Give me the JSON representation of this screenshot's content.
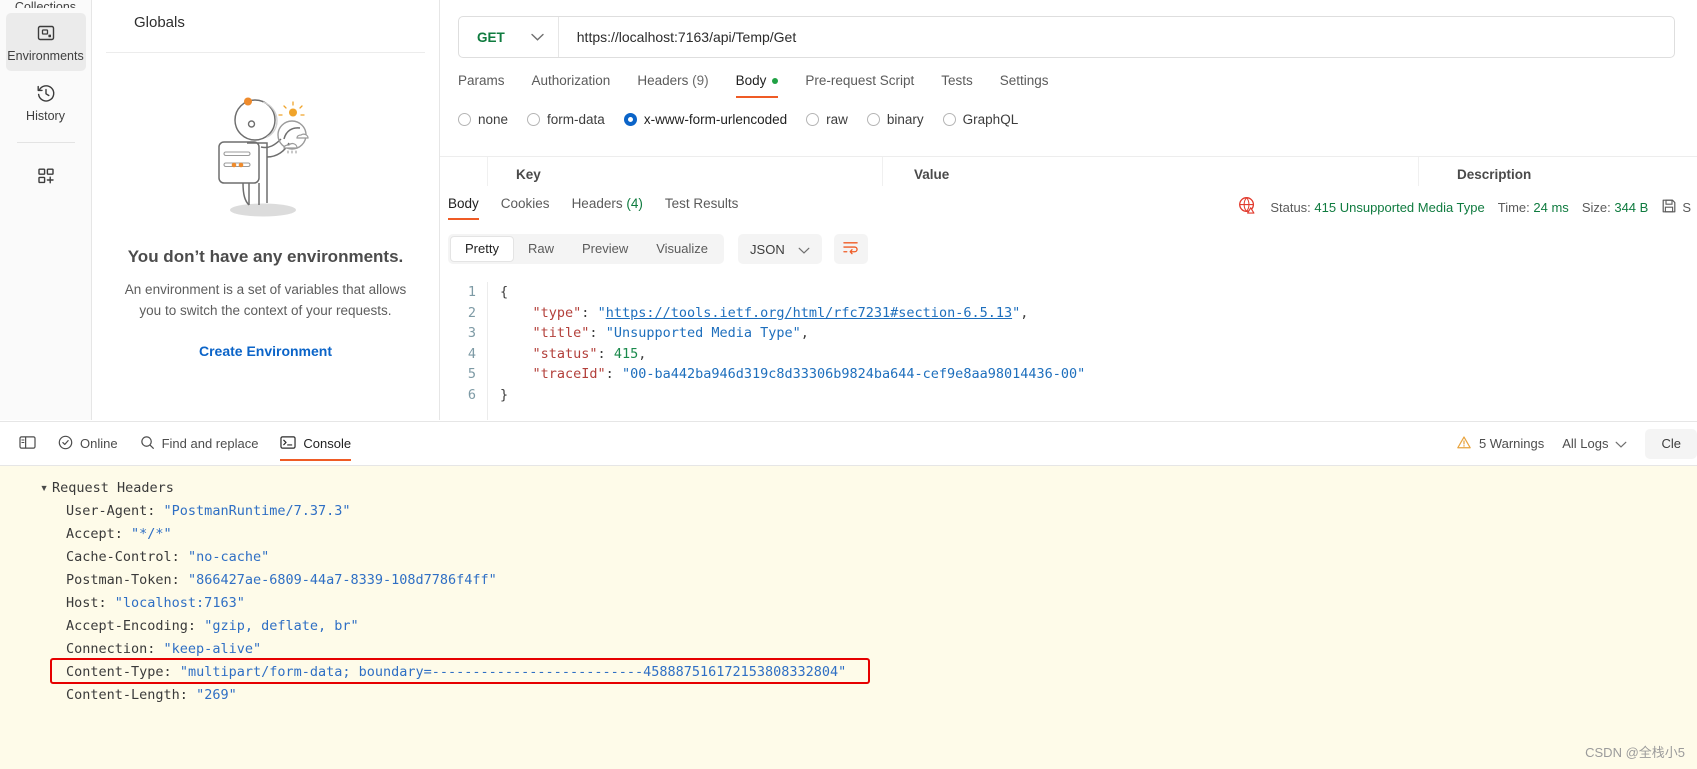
{
  "sidebar": {
    "items": [
      {
        "label": "Collections",
        "icon": "collections-icon",
        "active": false
      },
      {
        "label": "Environments",
        "icon": "environments-icon",
        "active": true
      },
      {
        "label": "History",
        "icon": "history-icon",
        "active": false
      },
      {
        "label": "",
        "icon": "add-apps-icon",
        "active": false
      }
    ]
  },
  "globals": {
    "title": "Globals",
    "empty_title": "You don’t have any environments.",
    "empty_desc": "An environment is a set of variables that allows you to switch the context of your requests.",
    "create_link": "Create Environment"
  },
  "request": {
    "method": "GET",
    "url": "https://localhost:7163/api/Temp/Get",
    "tabs": [
      {
        "label": "Params",
        "active": false
      },
      {
        "label": "Authorization",
        "active": false
      },
      {
        "label": "Headers",
        "count": "(9)",
        "active": false
      },
      {
        "label": "Body",
        "active": true,
        "dot": true
      },
      {
        "label": "Pre-request Script",
        "active": false
      },
      {
        "label": "Tests",
        "active": false
      },
      {
        "label": "Settings",
        "active": false
      }
    ],
    "body_types": [
      {
        "label": "none",
        "selected": false
      },
      {
        "label": "form-data",
        "selected": false
      },
      {
        "label": "x-www-form-urlencoded",
        "selected": true
      },
      {
        "label": "raw",
        "selected": false
      },
      {
        "label": "binary",
        "selected": false
      },
      {
        "label": "GraphQL",
        "selected": false
      }
    ],
    "table_headers": {
      "key": "Key",
      "value": "Value",
      "description": "Description"
    }
  },
  "response": {
    "tabs": [
      {
        "label": "Body",
        "active": true
      },
      {
        "label": "Cookies",
        "active": false
      },
      {
        "label": "Headers",
        "count": "(4)",
        "active": false
      },
      {
        "label": "Test Results",
        "active": false
      }
    ],
    "status_label": "Status:",
    "status_value": "415 Unsupported Media Type",
    "time_label": "Time:",
    "time_value": "24 ms",
    "size_label": "Size:",
    "size_value": "344 B",
    "save_label": "S",
    "view_modes": [
      {
        "label": "Pretty",
        "active": true
      },
      {
        "label": "Raw",
        "active": false
      },
      {
        "label": "Preview",
        "active": false
      },
      {
        "label": "Visualize",
        "active": false
      }
    ],
    "format": "JSON",
    "line_numbers": [
      "1",
      "2",
      "3",
      "4",
      "5",
      "6"
    ],
    "body_json": {
      "open_brace": "{",
      "close_brace": "}",
      "type_key": "\"type\"",
      "type_value": "https://tools.ietf.org/html/rfc7231#section-6.5.13",
      "title_key": "\"title\"",
      "title_value": "Unsupported Media Type",
      "status_key": "\"status\"",
      "status_value": "415",
      "traceid_key": "\"traceId\"",
      "traceid_value": "00-ba442ba946d319c8d33306b9824ba644-cef9e8aa98014436-00"
    }
  },
  "console": {
    "bar_items": [
      {
        "label": "",
        "icon": "layout-sidebar-icon",
        "active": false
      },
      {
        "label": "Online",
        "icon": "check-circle-icon",
        "active": false
      },
      {
        "label": "Find and replace",
        "icon": "search-icon",
        "active": false
      },
      {
        "label": "Console",
        "icon": "console-icon",
        "active": true
      }
    ],
    "warnings": "5 Warnings",
    "log_filter": "All Logs",
    "clear_label": "Cle",
    "section_title": "Request Headers",
    "headers": [
      {
        "name": "User-Agent:",
        "value": "\"PostmanRuntime/7.37.3\""
      },
      {
        "name": "Accept:",
        "value": "\"*/*\""
      },
      {
        "name": "Cache-Control:",
        "value": "\"no-cache\""
      },
      {
        "name": "Postman-Token:",
        "value": "\"866427ae-6809-44a7-8339-108d7786f4ff\""
      },
      {
        "name": "Host:",
        "value": "\"localhost:7163\""
      },
      {
        "name": "Accept-Encoding:",
        "value": "\"gzip, deflate, br\""
      },
      {
        "name": "Connection:",
        "value": "\"keep-alive\""
      },
      {
        "name": "Content-Type:",
        "value": "\"multipart/form-data; boundary=--------------------------458887516172153808332804\"",
        "highlighted": true
      },
      {
        "name": "Content-Length:",
        "value": "\"269\""
      }
    ]
  },
  "watermark": "CSDN @全栈小5",
  "colors": {
    "accent": "#ef5b25",
    "link": "#0b64c8",
    "success": "#0f7b3f",
    "warning": "#e8a33d",
    "error": "#e60000",
    "console_bg": "#fefbe9"
  }
}
